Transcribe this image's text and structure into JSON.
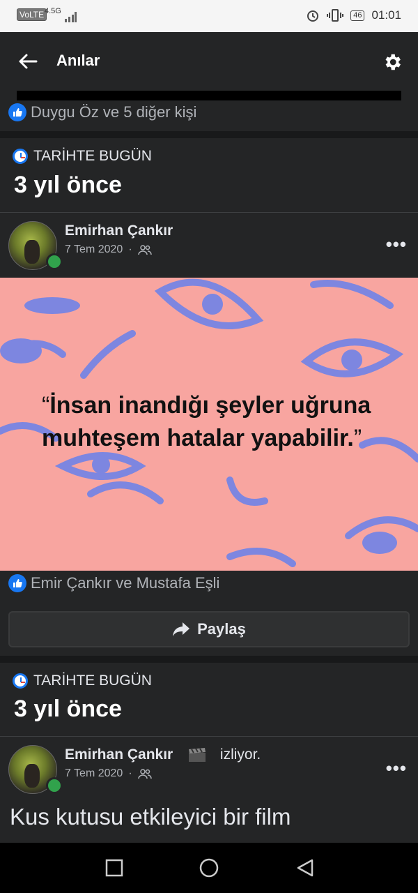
{
  "status_bar": {
    "volte": "VoLTE",
    "network": "4.5G",
    "battery": "46",
    "time": "01:01"
  },
  "app_bar": {
    "title": "Anılar"
  },
  "top_reactions": "Duygu Öz ve 5 diğer kişi",
  "memories": [
    {
      "label": "TARİHTE BUGÜN",
      "years_ago": "3 yıl önce",
      "author": "Emirhan Çankır",
      "date": "7 Tem 2020",
      "quote_open": "“",
      "quote_body": "İnsan inandığı şeyler uğruna muhteşem hatalar yapabilir.",
      "quote_close": "”",
      "reactions": "Emir Çankır ve Mustafa Eşli",
      "share_label": "Paylaş"
    },
    {
      "label": "TARİHTE BUGÜN",
      "years_ago": "3 yıl önce",
      "author": "Emirhan Çankır",
      "activity": "izliyor.",
      "date": "7 Tem 2020",
      "text": "Kus kutusu etkileyici bir film"
    }
  ],
  "colors": {
    "background": "#242526",
    "accent": "#1877f2",
    "quote_bg": "#f8a5a0",
    "online": "#31a24c"
  }
}
